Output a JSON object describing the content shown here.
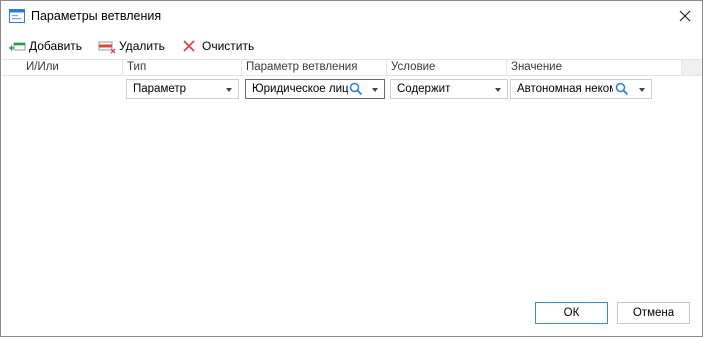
{
  "window": {
    "title": "Параметры ветвления"
  },
  "toolbar": {
    "add_label": "Добавить",
    "delete_label": "Удалить",
    "clear_label": "Очистить"
  },
  "grid": {
    "columns": [
      "И/Или",
      "Тип",
      "Параметр ветвления",
      "Условие",
      "Значение"
    ],
    "row": {
      "type": "Параметр",
      "parameter": "Юридическое лицо",
      "condition": "Содержит",
      "value": "Автономная некоммерческая"
    }
  },
  "buttons": {
    "ok": "ОК",
    "cancel": "Отмена"
  },
  "colors": {
    "accent": "#3d8fd1",
    "add_green": "#2e9b3e",
    "delete_red": "#d9453d",
    "clear_red": "#d9453d",
    "search_blue": "#2a7fd4"
  }
}
